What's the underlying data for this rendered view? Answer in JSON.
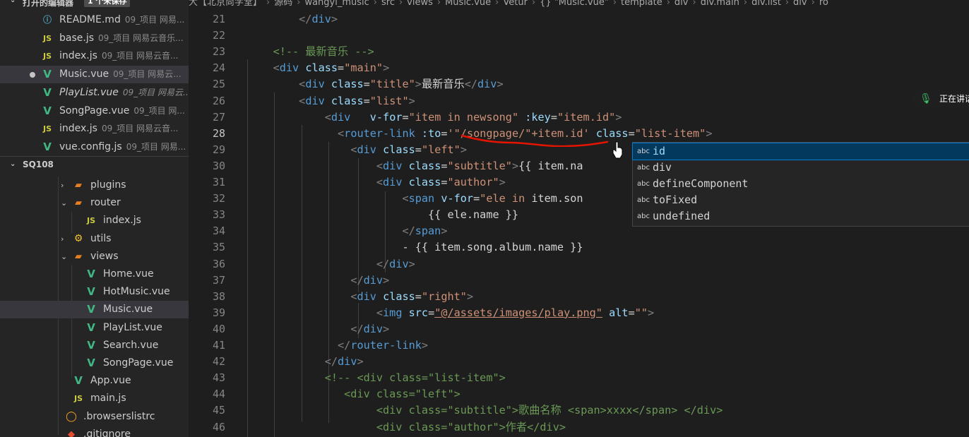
{
  "sidebar": {
    "open_editors_title": "打开的编辑器",
    "unsaved_badge": "1 个未保存",
    "open_editors": [
      {
        "icon": "md",
        "name": "README.md",
        "desc": "09_项目 网易..."
      },
      {
        "icon": "js",
        "name": "base.js",
        "desc": "09_项目 网易云音乐..."
      },
      {
        "icon": "js",
        "name": "index.js",
        "desc": "09_项目 网易云音..."
      },
      {
        "icon": "vue",
        "name": "Music.vue",
        "desc": "09_项目 网易云...",
        "modified": true,
        "active": true
      },
      {
        "icon": "vue",
        "name": "PlayList.vue",
        "desc": "09_项目 网易云...",
        "italic": true
      },
      {
        "icon": "vue",
        "name": "SongPage.vue",
        "desc": "09_项目 网..."
      },
      {
        "icon": "js",
        "name": "index.js",
        "desc": "09_项目 网易云音..."
      },
      {
        "icon": "vue",
        "name": "vue.config.js",
        "desc": "09_项目 网易..."
      }
    ],
    "project_title": "SQ108",
    "tree": [
      {
        "kind": "folder",
        "chev": "›",
        "name": "plugins",
        "level": 1
      },
      {
        "kind": "folder-open",
        "chev": "⌄",
        "name": "router",
        "level": 1
      },
      {
        "kind": "js",
        "name": "index.js",
        "level": 2
      },
      {
        "kind": "gear",
        "chev": "›",
        "name": "utils",
        "level": 1
      },
      {
        "kind": "folder-open",
        "chev": "⌄",
        "name": "views",
        "level": 1
      },
      {
        "kind": "vue",
        "name": "Home.vue",
        "level": 2
      },
      {
        "kind": "vue",
        "name": "HotMusic.vue",
        "level": 2
      },
      {
        "kind": "vue",
        "name": "Music.vue",
        "level": 2,
        "active": true
      },
      {
        "kind": "vue",
        "name": "PlayList.vue",
        "level": 2
      },
      {
        "kind": "vue",
        "name": "Search.vue",
        "level": 2
      },
      {
        "kind": "vue",
        "name": "SongPage.vue",
        "level": 2
      },
      {
        "kind": "vue",
        "name": "App.vue",
        "level": 1
      },
      {
        "kind": "js",
        "name": "main.js",
        "level": 1
      },
      {
        "kind": "browsers",
        "name": ".browserslistrc",
        "level": 0
      },
      {
        "kind": "git",
        "name": ".gitignore",
        "level": 0
      }
    ]
  },
  "breadcrumb": [
    "大【北京尚学堂】",
    "源码",
    "wangyi_music",
    "src",
    "views",
    "Music.vue",
    "Vetur",
    "{} \"Music.vue\"",
    "template",
    "div",
    "div.main",
    "div.list",
    "div",
    "ro"
  ],
  "editor": {
    "lines": [
      {
        "n": 21,
        "tokens": [
          [
            "t",
            "        "
          ],
          [
            "p",
            "</"
          ],
          [
            "g",
            "div"
          ],
          [
            "p",
            ">"
          ]
        ]
      },
      {
        "n": 22,
        "tokens": []
      },
      {
        "n": 23,
        "tokens": [
          [
            "t",
            "    "
          ],
          [
            "c",
            "<!-- 最新音乐 -->"
          ]
        ]
      },
      {
        "n": 24,
        "tokens": [
          [
            "t",
            "    "
          ],
          [
            "p",
            "<"
          ],
          [
            "g",
            "div"
          ],
          [
            "t",
            " "
          ],
          [
            "a",
            "class"
          ],
          [
            "t",
            "="
          ],
          [
            "s",
            "\"main\""
          ],
          [
            "p",
            ">"
          ]
        ]
      },
      {
        "n": 25,
        "tokens": [
          [
            "t",
            "        "
          ],
          [
            "p",
            "<"
          ],
          [
            "g",
            "div"
          ],
          [
            "t",
            " "
          ],
          [
            "a",
            "class"
          ],
          [
            "t",
            "="
          ],
          [
            "s",
            "\"title\""
          ],
          [
            "p",
            ">"
          ],
          [
            "t",
            "最新音乐"
          ],
          [
            "p",
            "</"
          ],
          [
            "g",
            "div"
          ],
          [
            "p",
            ">"
          ]
        ]
      },
      {
        "n": 26,
        "tokens": [
          [
            "t",
            "        "
          ],
          [
            "p",
            "<"
          ],
          [
            "g",
            "div"
          ],
          [
            "t",
            " "
          ],
          [
            "a",
            "class"
          ],
          [
            "t",
            "="
          ],
          [
            "s",
            "\"list\""
          ],
          [
            "p",
            ">"
          ]
        ]
      },
      {
        "n": 27,
        "tokens": [
          [
            "t",
            "            "
          ],
          [
            "p",
            "<"
          ],
          [
            "g",
            "div"
          ],
          [
            "t",
            "   "
          ],
          [
            "a",
            "v-for"
          ],
          [
            "t",
            "="
          ],
          [
            "s",
            "\"item in newsong\""
          ],
          [
            "t",
            " "
          ],
          [
            "a",
            ":key"
          ],
          [
            "t",
            "="
          ],
          [
            "s",
            "\"item.id\""
          ],
          [
            "p",
            ">"
          ]
        ]
      },
      {
        "n": 28,
        "tokens": [
          [
            "t",
            "              "
          ],
          [
            "p",
            "<"
          ],
          [
            "g",
            "router-link"
          ],
          [
            "t",
            " "
          ],
          [
            "a",
            ":to"
          ],
          [
            "t",
            "="
          ],
          [
            "s",
            "'\"/songpage/\"+item.id'"
          ],
          [
            "t",
            " "
          ],
          [
            "a",
            "class"
          ],
          [
            "t",
            "="
          ],
          [
            "s",
            "\"list-item\""
          ],
          [
            "p",
            ">"
          ]
        ],
        "current": true
      },
      {
        "n": 29,
        "tokens": [
          [
            "t",
            "                "
          ],
          [
            "p",
            "<"
          ],
          [
            "g",
            "div"
          ],
          [
            "t",
            " "
          ],
          [
            "a",
            "class"
          ],
          [
            "t",
            "="
          ],
          [
            "s",
            "\"left\""
          ],
          [
            "p",
            ">"
          ]
        ]
      },
      {
        "n": 30,
        "tokens": [
          [
            "t",
            "                    "
          ],
          [
            "p",
            "<"
          ],
          [
            "g",
            "div"
          ],
          [
            "t",
            " "
          ],
          [
            "a",
            "class"
          ],
          [
            "t",
            "="
          ],
          [
            "s",
            "\"subtitle\""
          ],
          [
            "p",
            ">"
          ],
          [
            "t",
            "{{ item.na"
          ]
        ]
      },
      {
        "n": 31,
        "tokens": [
          [
            "t",
            "                    "
          ],
          [
            "p",
            "<"
          ],
          [
            "g",
            "div"
          ],
          [
            "t",
            " "
          ],
          [
            "a",
            "class"
          ],
          [
            "t",
            "="
          ],
          [
            "s",
            "\"author\""
          ],
          [
            "p",
            ">"
          ]
        ]
      },
      {
        "n": 32,
        "tokens": [
          [
            "t",
            "                        "
          ],
          [
            "p",
            "<"
          ],
          [
            "g",
            "span"
          ],
          [
            "t",
            " "
          ],
          [
            "a",
            "v-for"
          ],
          [
            "t",
            "="
          ],
          [
            "s",
            "\"ele in "
          ],
          [
            "t",
            "item.son"
          ]
        ]
      },
      {
        "n": 33,
        "tokens": [
          [
            "t",
            "                            {{ ele.name }}"
          ]
        ]
      },
      {
        "n": 34,
        "tokens": [
          [
            "t",
            "                        "
          ],
          [
            "p",
            "</"
          ],
          [
            "g",
            "span"
          ],
          [
            "p",
            ">"
          ]
        ]
      },
      {
        "n": 35,
        "tokens": [
          [
            "t",
            "                        - {{ item.song.album.name }}"
          ]
        ]
      },
      {
        "n": 36,
        "tokens": [
          [
            "t",
            "                    "
          ],
          [
            "p",
            "</"
          ],
          [
            "g",
            "div"
          ],
          [
            "p",
            ">"
          ]
        ]
      },
      {
        "n": 37,
        "tokens": [
          [
            "t",
            "                "
          ],
          [
            "p",
            "</"
          ],
          [
            "g",
            "div"
          ],
          [
            "p",
            ">"
          ]
        ]
      },
      {
        "n": 38,
        "tokens": [
          [
            "t",
            "                "
          ],
          [
            "p",
            "<"
          ],
          [
            "g",
            "div"
          ],
          [
            "t",
            " "
          ],
          [
            "a",
            "class"
          ],
          [
            "t",
            "="
          ],
          [
            "s",
            "\"right\""
          ],
          [
            "p",
            ">"
          ]
        ]
      },
      {
        "n": 39,
        "tokens": [
          [
            "t",
            "                    "
          ],
          [
            "p",
            "<"
          ],
          [
            "g",
            "img"
          ],
          [
            "t",
            " "
          ],
          [
            "a",
            "src"
          ],
          [
            "t",
            "="
          ],
          [
            "u",
            "\"@/assets/images/play.png\""
          ],
          [
            "t",
            " "
          ],
          [
            "a",
            "alt"
          ],
          [
            "t",
            "="
          ],
          [
            "s",
            "\"\""
          ],
          [
            "p",
            ">"
          ]
        ]
      },
      {
        "n": 40,
        "tokens": [
          [
            "t",
            "                "
          ],
          [
            "p",
            "</"
          ],
          [
            "g",
            "div"
          ],
          [
            "p",
            ">"
          ]
        ]
      },
      {
        "n": 41,
        "tokens": [
          [
            "t",
            "              "
          ],
          [
            "p",
            "</"
          ],
          [
            "g",
            "router-link"
          ],
          [
            "p",
            ">"
          ]
        ]
      },
      {
        "n": 42,
        "tokens": [
          [
            "t",
            "            "
          ],
          [
            "p",
            "</"
          ],
          [
            "g",
            "div"
          ],
          [
            "p",
            ">"
          ]
        ]
      },
      {
        "n": 43,
        "tokens": [
          [
            "t",
            "            "
          ],
          [
            "c",
            "<!-- <div class=\"list-item\">"
          ]
        ]
      },
      {
        "n": 44,
        "tokens": [
          [
            "t",
            "               "
          ],
          [
            "c",
            "<div class=\"left\">"
          ]
        ]
      },
      {
        "n": 45,
        "tokens": [
          [
            "t",
            "                    "
          ],
          [
            "c",
            "<div class=\"subtitle\">歌曲名称 <span>xxxx</span> </div>"
          ]
        ]
      },
      {
        "n": 46,
        "tokens": [
          [
            "t",
            "                    "
          ],
          [
            "c",
            "<div class=\"author\">作者</div>"
          ]
        ]
      }
    ]
  },
  "autocomplete": {
    "kind_label": "abc",
    "items": [
      "id",
      "div",
      "defineComponent",
      "toFixed",
      "undefined"
    ],
    "selected_index": 0
  },
  "speech": {
    "label": "正在讲话"
  },
  "colors": {
    "accent": "#007fd4",
    "selection": "#04395e",
    "vue": "#41b883",
    "js": "#cbcb41",
    "squiggle": "#e51400"
  }
}
